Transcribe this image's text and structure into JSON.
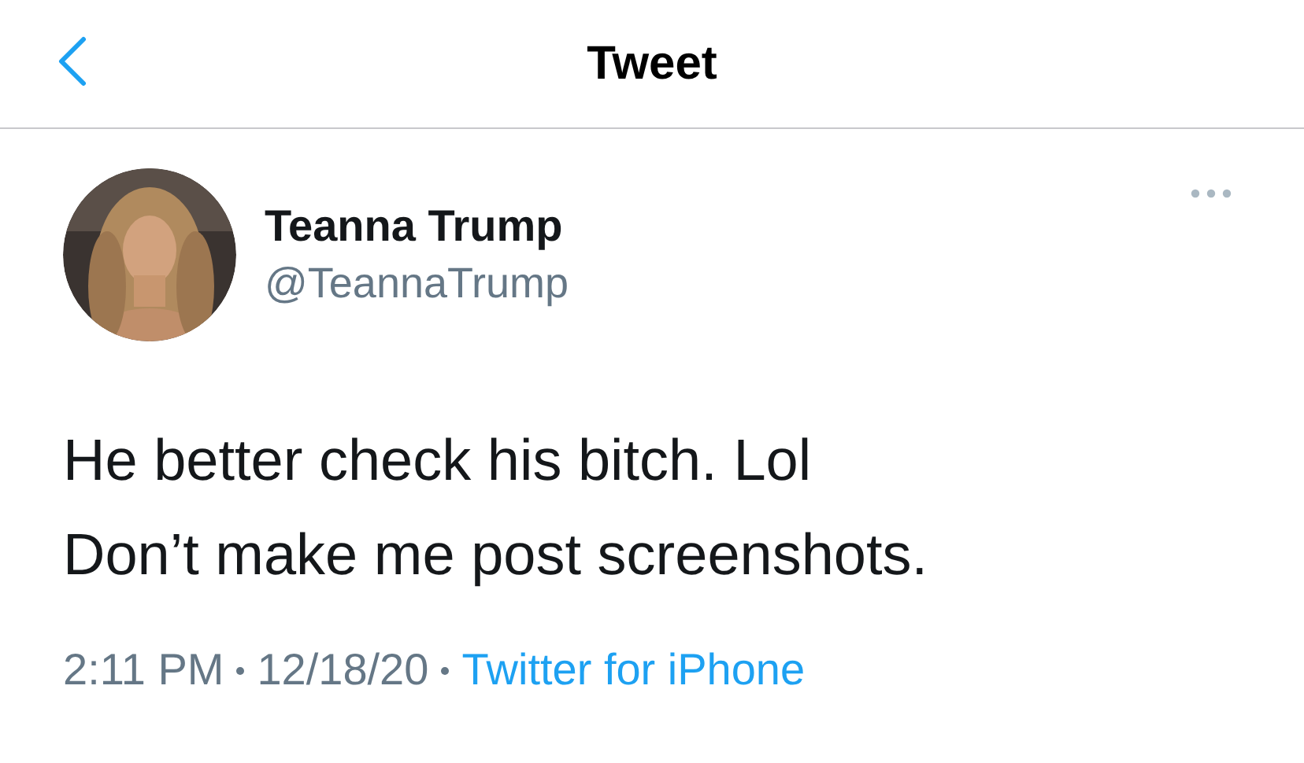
{
  "header": {
    "title": "Tweet"
  },
  "tweet": {
    "name": "Teanna Trump",
    "handle": "@TeannaTrump",
    "lines": [
      "He better check his bitch. Lol",
      "Don’t make me post screenshots."
    ],
    "time": "2:11 PM",
    "date": "12/18/20",
    "source": "Twitter for iPhone"
  }
}
